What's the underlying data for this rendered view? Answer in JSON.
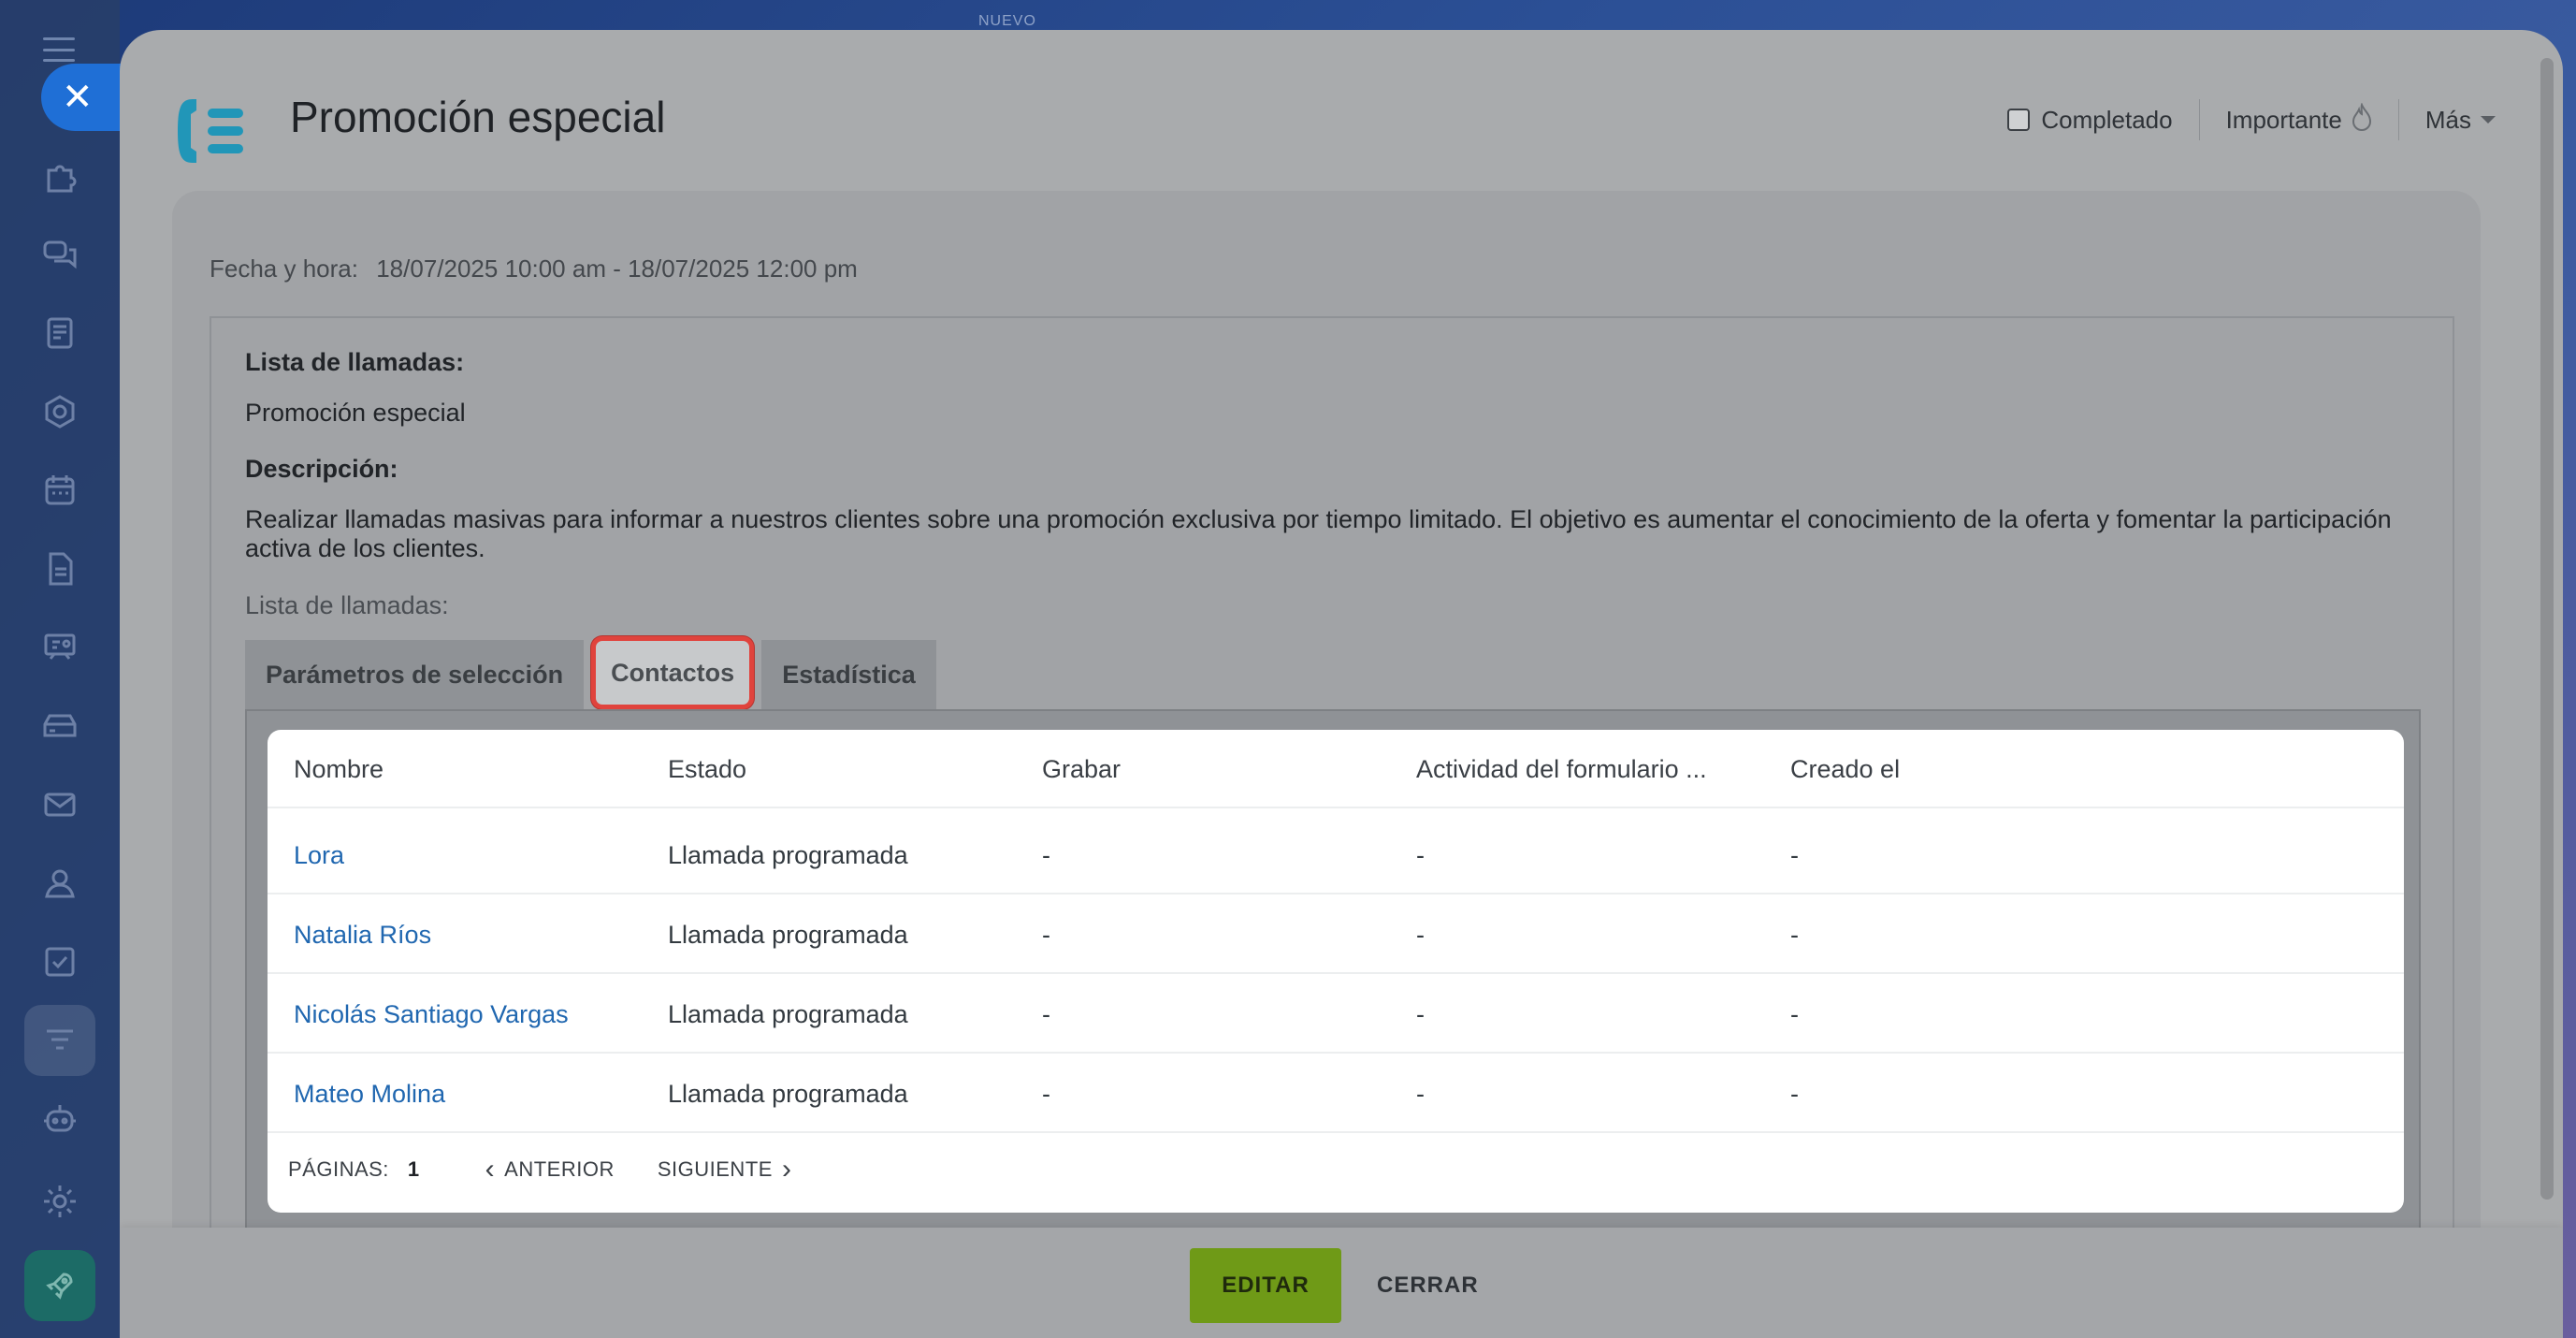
{
  "background": {
    "label": "NUEVO"
  },
  "header": {
    "title": "Promoción especial",
    "completed_label": "Completado",
    "important_label": "Importante",
    "more_label": "Más"
  },
  "details": {
    "datetime_label": "Fecha y hora:",
    "datetime_value": "18/07/2025 10:00 am - 18/07/2025 12:00 pm",
    "call_list_label": "Lista de llamadas:",
    "call_list_value": "Promoción especial",
    "description_label": "Descripción:",
    "description_line1": "Realizar llamadas masivas para informar a nuestros clientes sobre una promoción exclusiva por tiempo limitado. El objetivo es aumentar el conocimiento de la oferta y fomentar la participación",
    "description_line2": "activa de los clientes.",
    "list_sublabel": "Lista de llamadas:"
  },
  "tabs": [
    {
      "label": "Parámetros de selección",
      "selected": false
    },
    {
      "label": "Contactos",
      "selected": true
    },
    {
      "label": "Estadística",
      "selected": false
    }
  ],
  "table": {
    "columns": [
      "Nombre",
      "Estado",
      "Grabar",
      "Actividad del formulario ...",
      "Creado el"
    ],
    "rows": [
      {
        "name": "Lora",
        "status": "Llamada programada",
        "record": "-",
        "form_activity": "-",
        "created": "-"
      },
      {
        "name": "Natalia Ríos",
        "status": "Llamada programada",
        "record": "-",
        "form_activity": "-",
        "created": "-"
      },
      {
        "name": "Nicolás Santiago Vargas",
        "status": "Llamada programada",
        "record": "-",
        "form_activity": "-",
        "created": "-"
      },
      {
        "name": "Mateo Molina",
        "status": "Llamada programada",
        "record": "-",
        "form_activity": "-",
        "created": "-"
      }
    ]
  },
  "pagination": {
    "pages_label": "PÁGINAS:",
    "current_page": "1",
    "prev_label": "ANTERIOR",
    "next_label": "SIGUIENTE"
  },
  "footer": {
    "edit_label": "EDITAR",
    "close_label": "CERRAR"
  },
  "colors": {
    "accent_blue": "#1f6fd6",
    "edit_green": "#6f9a17",
    "highlight_red": "#e0433d",
    "link_blue": "#2067b0"
  },
  "sidebar_icons": [
    "puzzle-icon",
    "chat-icon",
    "feed-icon",
    "hexagon-icon",
    "calendar-icon",
    "document-icon",
    "presentation-icon",
    "drive-icon",
    "mail-icon",
    "contacts-icon",
    "tasks-icon",
    "filter-icon",
    "robot-icon",
    "settings-icon",
    "rocket-icon"
  ]
}
